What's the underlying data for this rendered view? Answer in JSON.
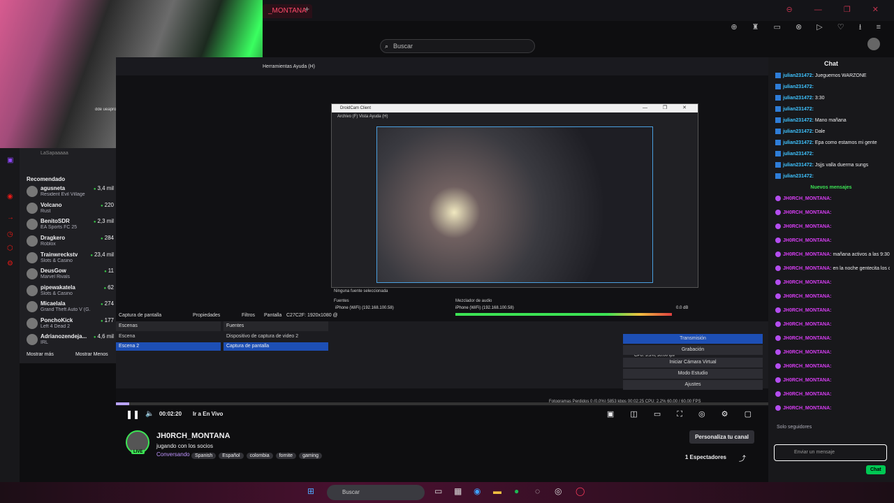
{
  "browser": {
    "tab_title": "_MONTANA",
    "search_placeholder": "Buscar"
  },
  "obs": {
    "menu": "Herramientas   Ayuda (H)",
    "droidcam_title": "DroidCam Client",
    "droidcam_menu": "Archivo (F)   Vista   Ayuda (H)",
    "no_source": "Ninguna fuente seleccionada",
    "sources_header": "Fuentes",
    "mixer_header": "Mezclador de audio",
    "source_item": "iPhone (WiFi) (192.168.100.58)",
    "mixer_item": "iPhone (WiFi) (192.168.100.58)",
    "mixer_db": "0.0 dB",
    "capture_label": "Captura de pantalla",
    "props_label": "Propiedades",
    "filters_label": "Filtros",
    "screen_label": "Pantalla",
    "screen_value": "C27C2F: 1920x1080 @",
    "scenes_header": "Escenas",
    "scene1": "Escena",
    "scene2": "Escena 2",
    "fuentes_header": "Fuentes",
    "src1": "Dispositivo de captura de video 2",
    "src2": "Captura de pantalla",
    "cpu": "CPU: 3.3%, 30.00 fps",
    "btn_transmision": "Transmisión",
    "btn_grabacion": "Grabación",
    "btn_virtual": "Iniciar Cámara Virtual",
    "btn_studio": "Modo Estudio",
    "btn_settings": "Ajustes",
    "status": "Fotogramas Perdidos 0 (0.0%)   5853 kbps   00:02:25   CPU: 2.2%   60.00 / 60.00 FPS"
  },
  "sidebar": {
    "top_user": "LaSapaaaaa",
    "heading": "Recomendado",
    "channels": [
      {
        "name": "agusneta",
        "game": "Resident Evil Village",
        "viewers": "3,4 mil"
      },
      {
        "name": "Volcano",
        "game": "Rust",
        "viewers": "220"
      },
      {
        "name": "BenitoSDR",
        "game": "EA Sports FC 25",
        "viewers": "2,3 mil"
      },
      {
        "name": "Dragkero",
        "game": "Roblox",
        "viewers": "284"
      },
      {
        "name": "Trainwreckstv",
        "game": "Slots & Casino",
        "viewers": "23,4 mil"
      },
      {
        "name": "DeusGow",
        "game": "Marvel Rivals",
        "viewers": "11"
      },
      {
        "name": "pipewakatela",
        "game": "Slots & Casino",
        "viewers": "62"
      },
      {
        "name": "Micaelala",
        "game": "Grand Theft Auto V (G...",
        "viewers": "274"
      },
      {
        "name": "PonchoKick",
        "game": "Left 4 Dead 2",
        "viewers": "177"
      },
      {
        "name": "Adrianozendeja...",
        "game": "IRL",
        "viewers": "4,6 mil"
      }
    ],
    "show_more": "Mostrar más",
    "show_less": "Mostrar Menos"
  },
  "player": {
    "time": "00:02:20",
    "go_live": "Ir a En Vivo",
    "progress": 0.02
  },
  "stream": {
    "streamer": "JH0RCH_MONTANA",
    "title": "jugando con los socios",
    "category": "Conversando",
    "tags": [
      "Spanish",
      "Español",
      "colombia",
      "fornite",
      "gaming"
    ],
    "live_badge": "LIVE",
    "customize": "Personaliza tu canal",
    "viewers": "1 Espectadores"
  },
  "chat": {
    "header": "Chat",
    "messages_old": [
      {
        "user": "julian231472:",
        "text": "Jueguemos WARZONE"
      },
      {
        "user": "julian231472:",
        "text": ""
      },
      {
        "user": "julian231472:",
        "text": "3:30"
      },
      {
        "user": "julian231472:",
        "text": ""
      },
      {
        "user": "julian231472:",
        "text": "Mano mañana"
      },
      {
        "user": "julian231472:",
        "text": "Dale"
      },
      {
        "user": "julian231472:",
        "text": "Epa como estamos mi gente"
      },
      {
        "user": "julian231472:",
        "text": ""
      },
      {
        "user": "julian231472:",
        "text": "Jsjjs valla duerma sungs"
      },
      {
        "user": "julian231472:",
        "text": ""
      }
    ],
    "new_label": "Nuevos mensajes",
    "messages_new": [
      {
        "user": "JH0RCH_MONTANA:",
        "text": ""
      },
      {
        "user": "JH0RCH_MONTANA:",
        "text": ""
      },
      {
        "user": "JH0RCH_MONTANA:",
        "text": ""
      },
      {
        "user": "JH0RCH_MONTANA:",
        "text": ""
      },
      {
        "user": "JH0RCH_MONTANA:",
        "text": "mañana activos a las 9:30"
      },
      {
        "user": "JH0RCH_MONTANA:",
        "text": "en la noche gentecita los quiero"
      },
      {
        "user": "JH0RCH_MONTANA:",
        "text": ""
      },
      {
        "user": "JH0RCH_MONTANA:",
        "text": ""
      },
      {
        "user": "JH0RCH_MONTANA:",
        "text": ""
      },
      {
        "user": "JH0RCH_MONTANA:",
        "text": ""
      },
      {
        "user": "JH0RCH_MONTANA:",
        "text": ""
      },
      {
        "user": "JH0RCH_MONTANA:",
        "text": ""
      },
      {
        "user": "JH0RCH_MONTANA:",
        "text": ""
      },
      {
        "user": "JH0RCH_MONTANA:",
        "text": ""
      },
      {
        "user": "JH0RCH_MONTANA:",
        "text": ""
      },
      {
        "user": "JH0RCH_MONTANA:",
        "text": ""
      }
    ],
    "followers_only": "Solo seguidores",
    "input_placeholder": "Enviar un mensaje",
    "send_button": "Chat"
  },
  "taskbar": {
    "search": "Buscar"
  },
  "colors": {
    "accent": "#9147ff",
    "live": "#3ce354",
    "brand_red": "#e91916"
  }
}
